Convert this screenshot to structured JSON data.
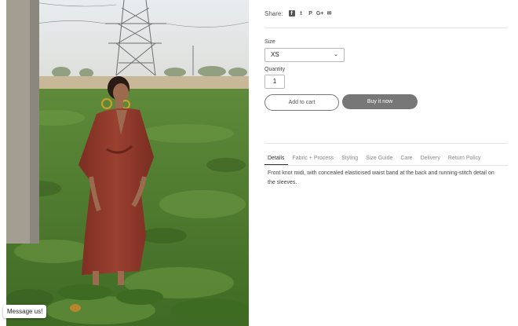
{
  "chat": {
    "message_label": "Message us!"
  },
  "share": {
    "label": "Share:",
    "icons": [
      {
        "name": "facebook-icon",
        "glyph": "f"
      },
      {
        "name": "twitter-icon",
        "glyph": "t"
      },
      {
        "name": "pinterest-icon",
        "glyph": "P"
      },
      {
        "name": "google-plus-icon",
        "glyph": "G+"
      },
      {
        "name": "email-icon",
        "glyph": "✉"
      }
    ]
  },
  "product_form": {
    "size_label": "Size",
    "size_value": "XS",
    "quantity_label": "Quantity",
    "quantity_value": "1",
    "add_to_cart_label": "Add to cart",
    "buy_now_label": "Buy it now"
  },
  "tabs": [
    {
      "label": "Details",
      "active": true
    },
    {
      "label": "Fabric + Process",
      "active": false
    },
    {
      "label": "Styling",
      "active": false
    },
    {
      "label": "Size Guide",
      "active": false
    },
    {
      "label": "Care",
      "active": false
    },
    {
      "label": "Delivery",
      "active": false
    },
    {
      "label": "Return Policy",
      "active": false
    }
  ],
  "details": {
    "text": "Front knot midi, with concealed elasticised waist band at the back and running-stitch detail on the sleeves."
  },
  "colors": {
    "buy_button": "#777777",
    "dress": "#8e3a2b",
    "foliage": "#4f7a2f"
  }
}
